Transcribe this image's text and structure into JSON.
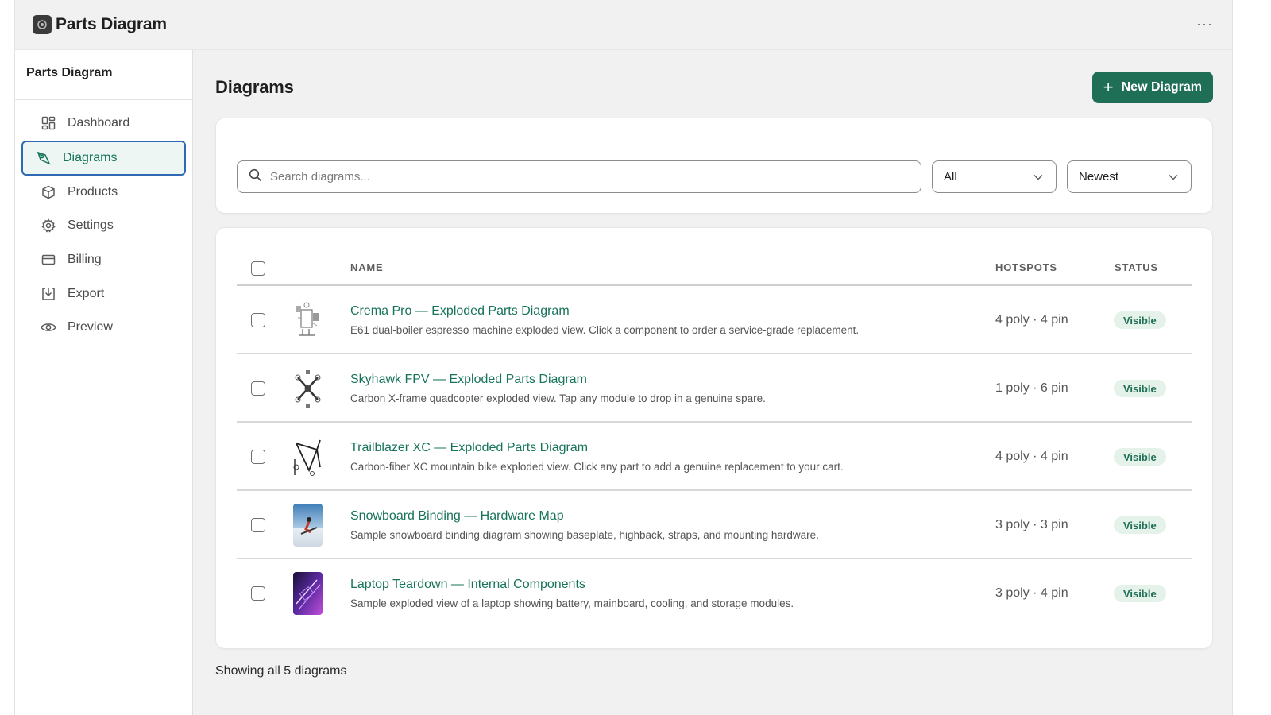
{
  "app": {
    "title": "Parts Diagram",
    "more": "···"
  },
  "sidebar": {
    "title": "Parts Diagram",
    "items": [
      {
        "label": "Dashboard",
        "icon": "dashboard-icon"
      },
      {
        "label": "Diagrams",
        "icon": "diagram-icon",
        "active": true
      },
      {
        "label": "Products",
        "icon": "box-icon"
      },
      {
        "label": "Settings",
        "icon": "gear-icon"
      },
      {
        "label": "Billing",
        "icon": "credit-card-icon"
      },
      {
        "label": "Export",
        "icon": "download-icon"
      },
      {
        "label": "Preview",
        "icon": "eye-icon"
      }
    ]
  },
  "page": {
    "title": "Diagrams",
    "new_button": "New Diagram"
  },
  "filters": {
    "search_placeholder": "Search diagrams...",
    "type_value": "All",
    "sort_value": "Newest"
  },
  "table": {
    "columns": {
      "name": "NAME",
      "hotspots": "HOTSPOTS",
      "status": "STATUS"
    },
    "rows": [
      {
        "title": "Crema Pro — Exploded Parts Diagram",
        "desc": "E61 dual-boiler espresso machine exploded view. Click a component to order a service-grade replacement.",
        "hotspots": "4 poly · 4 pin",
        "status": "Visible"
      },
      {
        "title": "Skyhawk FPV — Exploded Parts Diagram",
        "desc": "Carbon X-frame quadcopter exploded view. Tap any module to drop in a genuine spare.",
        "hotspots": "1 poly · 6 pin",
        "status": "Visible"
      },
      {
        "title": "Trailblazer XC — Exploded Parts Diagram",
        "desc": "Carbon-fiber XC mountain bike exploded view. Click any part to add a genuine replacement to your cart.",
        "hotspots": "4 poly · 4 pin",
        "status": "Visible"
      },
      {
        "title": "Snowboard Binding — Hardware Map",
        "desc": "Sample snowboard binding diagram showing baseplate, highback, straps, and mounting hardware.",
        "hotspots": "3 poly · 3 pin",
        "status": "Visible"
      },
      {
        "title": "Laptop Teardown — Internal Components",
        "desc": "Sample exploded view of a laptop showing battery, mainboard, cooling, and storage modules.",
        "hotspots": "3 poly · 4 pin",
        "status": "Visible"
      }
    ]
  },
  "footer": {
    "count": "Showing all 5 diagrams"
  },
  "colors": {
    "accent": "#1f6f56",
    "link": "#17735a",
    "active_border": "#2d69b5",
    "badge_bg": "#e4f2ea"
  }
}
